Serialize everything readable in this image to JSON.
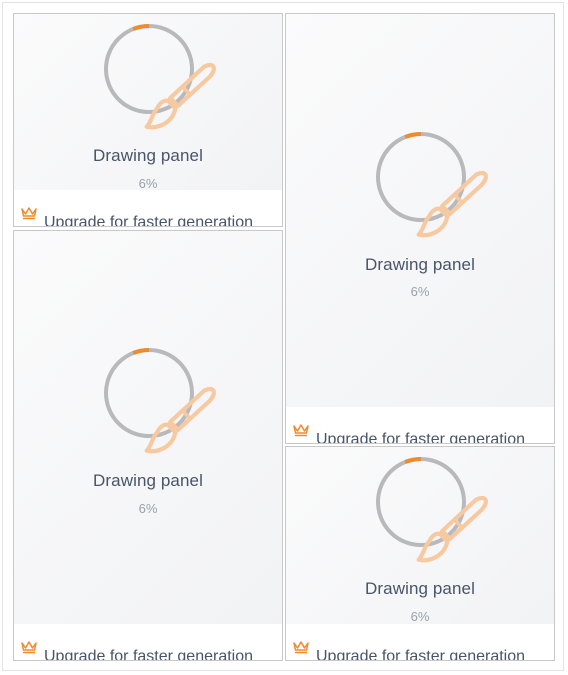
{
  "colors": {
    "accent": "#f08a2b",
    "ring_track": "#b9b9bc",
    "icon_faded": "#f7c9a0",
    "title_text": "#485568",
    "percent_text": "#9aa1ab",
    "card_border": "#c8c8cb"
  },
  "cards": [
    {
      "title": "Drawing panel",
      "percent_label": "6%",
      "progress": 0.06,
      "upgrade_label": "Upgrade for faster generation",
      "icon": "paintbrush-icon",
      "badge_icon": "crown-icon"
    },
    {
      "title": "Drawing panel",
      "percent_label": "6%",
      "progress": 0.06,
      "upgrade_label": "Upgrade for faster generation",
      "icon": "paintbrush-icon",
      "badge_icon": "crown-icon"
    },
    {
      "title": "Drawing panel",
      "percent_label": "6%",
      "progress": 0.06,
      "upgrade_label": "Upgrade for faster generation",
      "icon": "paintbrush-icon",
      "badge_icon": "crown-icon"
    },
    {
      "title": "Drawing panel",
      "percent_label": "6%",
      "progress": 0.06,
      "upgrade_label": "Upgrade for faster generation",
      "icon": "paintbrush-icon",
      "badge_icon": "crown-icon"
    }
  ]
}
